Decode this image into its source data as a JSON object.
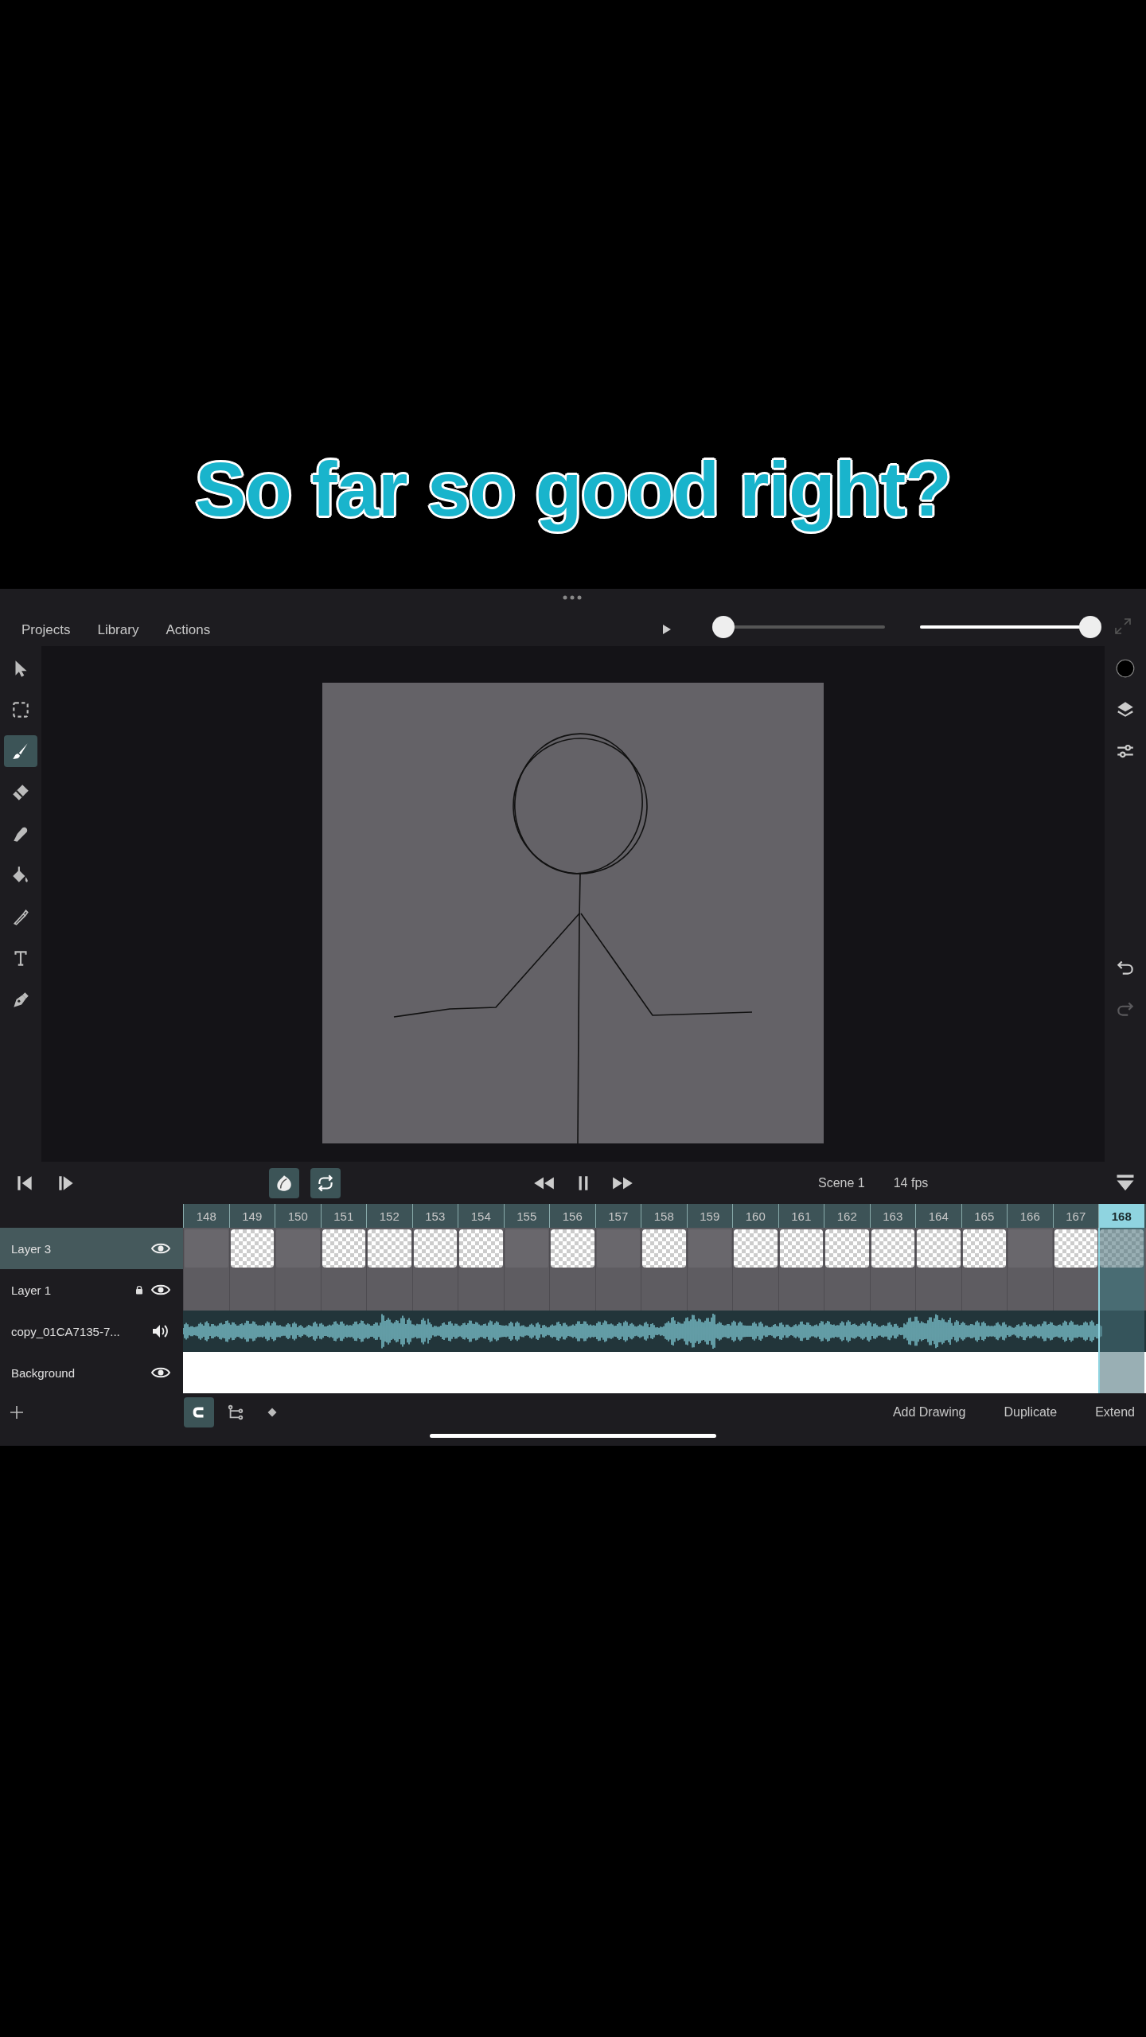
{
  "caption": "So far so good right?",
  "menu": [
    "Projects",
    "Library",
    "Actions"
  ],
  "sliders": [
    {
      "level": 0.05
    },
    {
      "level": 1
    }
  ],
  "tools": [
    {
      "kind": "select",
      "selected": false
    },
    {
      "kind": "marquee",
      "selected": false
    },
    {
      "kind": "brush",
      "selected": true
    },
    {
      "kind": "eraser",
      "selected": false
    },
    {
      "kind": "smudge",
      "selected": false
    },
    {
      "kind": "fill",
      "selected": false
    },
    {
      "kind": "eyedropper",
      "selected": false
    },
    {
      "kind": "text",
      "selected": false
    },
    {
      "kind": "pen",
      "selected": false
    }
  ],
  "right_tools": [
    {
      "kind": "color"
    },
    {
      "kind": "layers"
    },
    {
      "kind": "adjust"
    },
    {
      "kind": "undo"
    },
    {
      "kind": "redo",
      "disabled": true
    }
  ],
  "transport": {
    "onion_skin": {
      "on": true
    },
    "loop": {
      "on": true
    },
    "scene": "Scene 1",
    "fps": "14 fps"
  },
  "timeline": {
    "frames": [
      {
        "label": "148",
        "selected": false
      },
      {
        "label": "149",
        "selected": false
      },
      {
        "label": "150",
        "selected": false
      },
      {
        "label": "151",
        "selected": false
      },
      {
        "label": "152",
        "selected": false
      },
      {
        "label": "153",
        "selected": false
      },
      {
        "label": "154",
        "selected": false
      },
      {
        "label": "155",
        "selected": false
      },
      {
        "label": "156",
        "selected": false
      },
      {
        "label": "157",
        "selected": false
      },
      {
        "label": "158",
        "selected": false
      },
      {
        "label": "159",
        "selected": false
      },
      {
        "label": "160",
        "selected": false
      },
      {
        "label": "161",
        "selected": false
      },
      {
        "label": "162",
        "selected": false
      },
      {
        "label": "163",
        "selected": false
      },
      {
        "label": "164",
        "selected": false
      },
      {
        "label": "165",
        "selected": false
      },
      {
        "label": "166",
        "selected": false
      },
      {
        "label": "167",
        "selected": false
      },
      {
        "label": "168",
        "selected": true
      }
    ],
    "layers": [
      {
        "name": "Layer 3",
        "kind": "drawing",
        "selected": true,
        "locked": false,
        "keyframes": [
          false,
          true,
          false,
          true,
          true,
          true,
          true,
          false,
          true,
          false,
          true,
          false,
          true,
          true,
          true,
          true,
          true,
          true,
          false,
          true,
          true
        ]
      },
      {
        "name": "Layer 1",
        "kind": "drawing",
        "selected": false,
        "locked": true
      },
      {
        "name": "copy_01CA7135-7...",
        "kind": "audio",
        "selected": false,
        "locked": false
      },
      {
        "name": "Background",
        "kind": "fill",
        "selected": false,
        "locked": false
      }
    ]
  },
  "bottom_tools": [
    {
      "kind": "snap",
      "selected": true
    },
    {
      "kind": "branch",
      "selected": false
    },
    {
      "kind": "keyframe",
      "selected": false
    }
  ],
  "actions": [
    "Add Drawing",
    "Duplicate",
    "Extend"
  ]
}
